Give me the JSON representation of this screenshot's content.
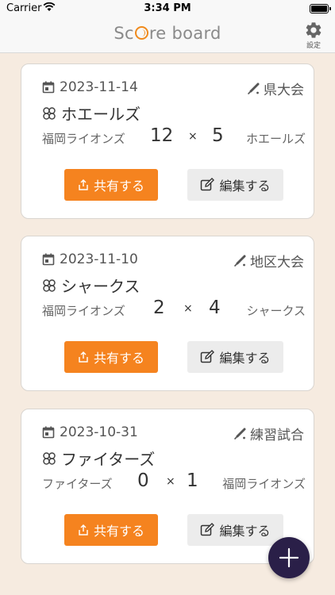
{
  "status_bar": {
    "carrier": "Carrier",
    "time": "3:34 PM"
  },
  "nav": {
    "title_before": "Sc",
    "title_after": "re board",
    "settings_label": "設定"
  },
  "buttons": {
    "share": "共有する",
    "edit": "編集する"
  },
  "games": [
    {
      "date": "2023-11-14",
      "type": "県大会",
      "opponent": "ホエールズ",
      "home_team": "福岡ライオンズ",
      "home_score": "12",
      "away_score": "5",
      "away_team": "ホエールズ"
    },
    {
      "date": "2023-11-10",
      "type": "地区大会",
      "opponent": "シャークス",
      "home_team": "福岡ライオンズ",
      "home_score": "2",
      "away_score": "4",
      "away_team": "シャークス"
    },
    {
      "date": "2023-10-31",
      "type": "練習試合",
      "opponent": "ファイターズ",
      "home_team": "ファイターズ",
      "home_score": "0",
      "away_score": "1",
      "away_team": "福岡ライオンズ"
    }
  ],
  "score_separator": "×",
  "colors": {
    "accent": "#f5831f",
    "fab": "#2a1f48",
    "background": "#f6ebe0"
  }
}
